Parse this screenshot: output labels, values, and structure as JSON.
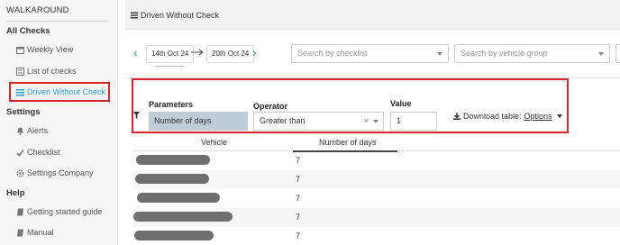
{
  "sidebar": {
    "brand": "WALKAROUND",
    "sections": {
      "all_checks": "All Checks",
      "settings": "Settings",
      "help": "Help"
    },
    "items": {
      "weekly_view": "Weekly View",
      "list_of_checks": "List of checks",
      "driven_without_check": "Driven Without Check",
      "alerts": "Alerts",
      "checklist": "Checklist",
      "settings_company": "Settings Company",
      "getting_started": "Getting started guide",
      "manual": "Manual"
    },
    "active_item": "driven_without_check"
  },
  "header": {
    "title": "Driven Without Check"
  },
  "date_range": {
    "start": "14th Oct 24",
    "end": "20th Oct 24"
  },
  "filters": {
    "checklist_placeholder": "Search by checklist",
    "vehicle_group_placeholder": "Search by vehicle group"
  },
  "parameters": {
    "parameters_label": "Parameters",
    "operator_label": "Operator",
    "value_label": "Value",
    "parameter_value": "Number of days",
    "operator_value": "Greater than",
    "clear_symbol": "×",
    "value_input": "1",
    "download_label": "Download table:",
    "options_label": "Options"
  },
  "table": {
    "columns": [
      "Vehicle",
      "Number of days"
    ],
    "rows": [
      {
        "vehicle": "",
        "days": "7"
      },
      {
        "vehicle": "",
        "days": "7"
      },
      {
        "vehicle": "",
        "days": "7"
      },
      {
        "vehicle": "",
        "days": "7"
      },
      {
        "vehicle": "",
        "days": "7"
      }
    ]
  },
  "colors": {
    "accent": "#2a9fd6",
    "highlight": "#d9262a",
    "param_box": "#bfcdd6"
  }
}
